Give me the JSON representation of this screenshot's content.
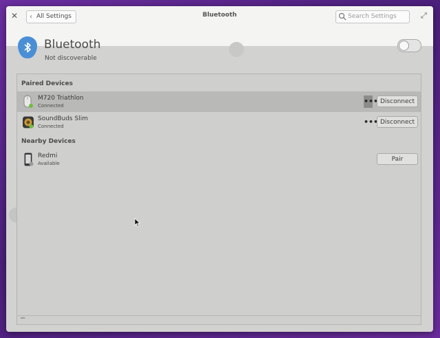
{
  "window": {
    "title": "Bluetooth",
    "back_label": "All Settings",
    "search_placeholder": "Search Settings"
  },
  "header": {
    "title": "Bluetooth",
    "subtitle": "Not discoverable",
    "toggle_on": false,
    "icon": "bluetooth-icon",
    "accent": "#4a8fd6"
  },
  "sections": {
    "paired_title": "Paired Devices",
    "nearby_title": "Nearby Devices"
  },
  "paired_devices": [
    {
      "name": "M720 Triathlon",
      "status": "Connected",
      "icon": "mouse-icon",
      "action": "Disconnect",
      "more": "•••"
    },
    {
      "name": "SoundBuds Slim",
      "status": "Connected",
      "icon": "headphones-icon",
      "action": "Disconnect",
      "more": "•••"
    }
  ],
  "nearby_devices": [
    {
      "name": "Redmi",
      "status": "Available",
      "icon": "phone-icon",
      "action": "Pair"
    }
  ],
  "footer": {
    "remove_label": "−"
  }
}
